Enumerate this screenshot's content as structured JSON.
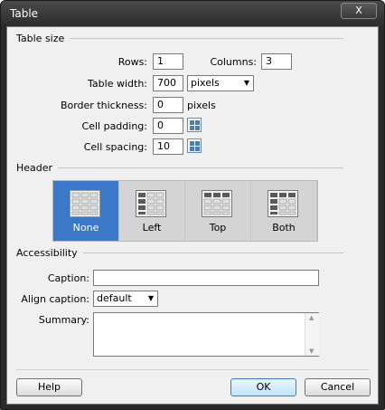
{
  "window": {
    "title": "Table",
    "close_glyph": "X"
  },
  "table_size": {
    "heading": "Table size",
    "rows_label": "Rows:",
    "rows_value": "1",
    "columns_label": "Columns:",
    "columns_value": "3",
    "width_label": "Table width:",
    "width_value": "700",
    "width_unit": "pixels",
    "border_label": "Border thickness:",
    "border_value": "0",
    "border_unit": "pixels",
    "padding_label": "Cell padding:",
    "padding_value": "0",
    "spacing_label": "Cell spacing:",
    "spacing_value": "10"
  },
  "header": {
    "heading": "Header",
    "options": [
      {
        "label": "None",
        "selected": true
      },
      {
        "label": "Left",
        "selected": false
      },
      {
        "label": "Top",
        "selected": false
      },
      {
        "label": "Both",
        "selected": false
      }
    ]
  },
  "accessibility": {
    "heading": "Accessibility",
    "caption_label": "Caption:",
    "caption_value": "",
    "align_label": "Align caption:",
    "align_value": "default",
    "summary_label": "Summary:",
    "summary_value": ""
  },
  "buttons": {
    "help": "Help",
    "ok": "OK",
    "cancel": "Cancel"
  },
  "colors": {
    "selected": "#3b78c9",
    "dialog_bg": "#f0f0f0"
  }
}
